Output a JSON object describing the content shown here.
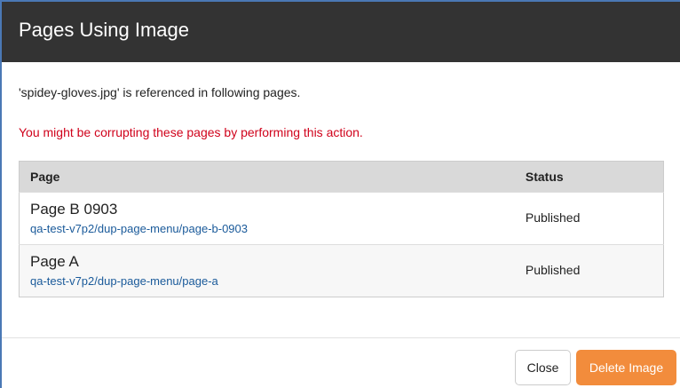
{
  "dialog": {
    "title": "Pages Using Image",
    "info": "'spidey-gloves.jpg' is referenced in following pages.",
    "warning": "You might be corrupting these pages by performing this action."
  },
  "table": {
    "headers": {
      "page": "Page",
      "status": "Status"
    },
    "rows": [
      {
        "name": "Page B 0903",
        "path": "qa-test-v7p2/dup-page-menu/page-b-0903",
        "status": "Published"
      },
      {
        "name": "Page A",
        "path": "qa-test-v7p2/dup-page-menu/page-a",
        "status": "Published"
      }
    ]
  },
  "footer": {
    "close_label": "Close",
    "delete_label": "Delete Image"
  },
  "colors": {
    "header_bg": "#333333",
    "warning": "#d0021b",
    "link": "#1a5a9a",
    "delete_button": "#f28c3c"
  }
}
